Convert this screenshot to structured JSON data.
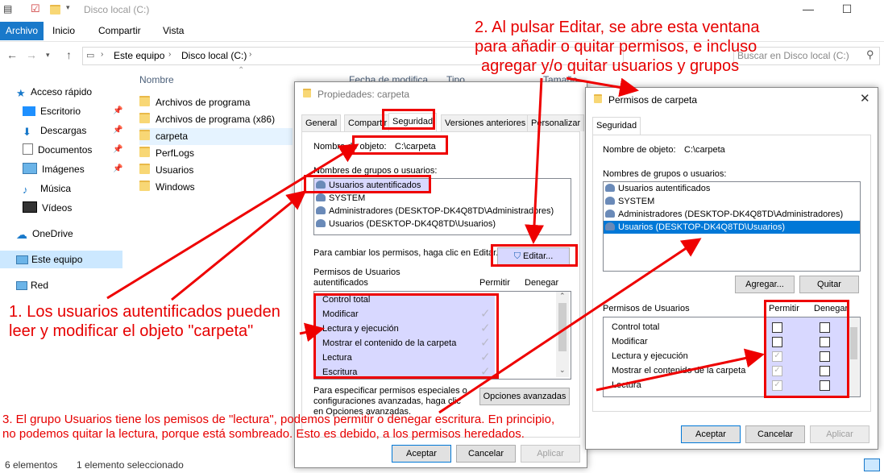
{
  "explorer": {
    "title": "Disco local (C:)",
    "ribbon_tabs": [
      "Archivo",
      "Inicio",
      "Compartir",
      "Vista"
    ],
    "breadcrumb": [
      "Este equipo",
      "Disco local (C:)"
    ],
    "search_placeholder": "Buscar en Disco local (C:)",
    "nav": {
      "quick_access": "Acceso rápido",
      "items": [
        "Escritorio",
        "Descargas",
        "Documentos",
        "Imágenes",
        "Música",
        "Vídeos"
      ],
      "onedrive": "OneDrive",
      "this_pc": "Este equipo",
      "network": "Red"
    },
    "columns": {
      "name": "Nombre",
      "date": "Fecha de modifica...",
      "type": "Tipo",
      "size": "Tamaño"
    },
    "files": [
      "Archivos de programa",
      "Archivos de programa (x86)",
      "carpeta",
      "PerfLogs",
      "Usuarios",
      "Windows"
    ],
    "status": {
      "count": "6 elementos",
      "selected": "1 elemento seleccionado"
    }
  },
  "properties": {
    "title": "Propiedades: carpeta",
    "tabs": [
      "General",
      "Compartir",
      "Seguridad",
      "Versiones anteriores",
      "Personalizar"
    ],
    "object_label": "Nombre de objeto:",
    "object_value": "C:\\carpeta",
    "groups_label": "Nombres de grupos o usuarios:",
    "users": [
      "Usuarios autentificados",
      "SYSTEM",
      "Administradores (DESKTOP-DK4Q8TD\\Administradores)",
      "Usuarios (DESKTOP-DK4Q8TD\\Usuarios)"
    ],
    "change_hint": "Para cambiar los permisos, haga clic en Editar.",
    "edit_button": "Editar...",
    "perm_label_1": "Permisos de Usuarios",
    "perm_label_2": "autentificados",
    "allow_header": "Permitir",
    "deny_header": "Denegar",
    "permissions": [
      "Control total",
      "Modificar",
      "Lectura y ejecución",
      "Mostrar el contenido de la carpeta",
      "Lectura",
      "Escritura"
    ],
    "special_1": "Para especificar permisos especiales o",
    "special_2": "configuraciones avanzadas, haga clic",
    "special_3": "en Opciones avanzadas.",
    "advanced_button": "Opciones avanzadas",
    "ok": "Aceptar",
    "cancel": "Cancelar",
    "apply": "Aplicar"
  },
  "permissions_dialog": {
    "title": "Permisos de carpeta",
    "tab": "Seguridad",
    "object_label": "Nombre de objeto:",
    "object_value": "C:\\carpeta",
    "groups_label": "Nombres de grupos o usuarios:",
    "users": [
      "Usuarios autentificados",
      "SYSTEM",
      "Administradores (DESKTOP-DK4Q8TD\\Administradores)",
      "Usuarios (DESKTOP-DK4Q8TD\\Usuarios)"
    ],
    "add_button": "Agregar...",
    "remove_button": "Quitar",
    "perm_label": "Permisos de Usuarios",
    "allow_header": "Permitir",
    "deny_header": "Denegar",
    "permissions": [
      "Control total",
      "Modificar",
      "Lectura y ejecución",
      "Mostrar el contenido de la carpeta",
      "Lectura"
    ],
    "ok": "Aceptar",
    "cancel": "Cancelar",
    "apply": "Aplicar"
  },
  "annotations": {
    "a1_line1": "1. Los usuarios autentificados pueden",
    "a1_line2": "leer y modificar el objeto \"carpeta\"",
    "a2_line1": "2. Al pulsar Editar, se abre esta ventana",
    "a2_line2": "para añadir o quitar permisos, e incluso",
    "a2_line3": "agregar y/o quitar usuarios y grupos",
    "a3_line1": "3. El grupo Usuarios tiene los pemisos de \"lectura\", podemos permitir o denegar escritura. En principio,",
    "a3_line2": "no podemos quitar la lectura, porque está sombreado. Esto es debido, a los permisos heredados."
  }
}
